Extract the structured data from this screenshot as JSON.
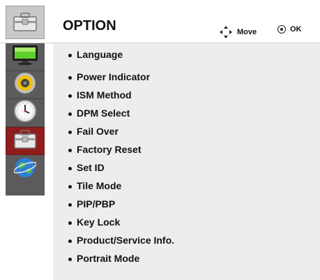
{
  "header": {
    "title": "OPTION",
    "move_label": "Move",
    "ok_label": "OK"
  },
  "sidebar": {
    "items": [
      {
        "icon": "monitor-icon"
      },
      {
        "icon": "speaker-icon"
      },
      {
        "icon": "clock-icon"
      },
      {
        "icon": "toolbox-icon",
        "active": true
      },
      {
        "icon": "globe-icon"
      }
    ]
  },
  "menu": {
    "items": [
      "Language",
      "Power Indicator",
      "ISM Method",
      "DPM Select",
      "Fail Over",
      "Factory Reset",
      "Set ID",
      "Tile Mode",
      "PIP/PBP",
      "Key Lock",
      "Product/Service Info.",
      "Portrait Mode"
    ]
  },
  "colors": {
    "panel": "#ededed",
    "sidebar": "#5b5b5b",
    "active": "#8f1d1d"
  }
}
